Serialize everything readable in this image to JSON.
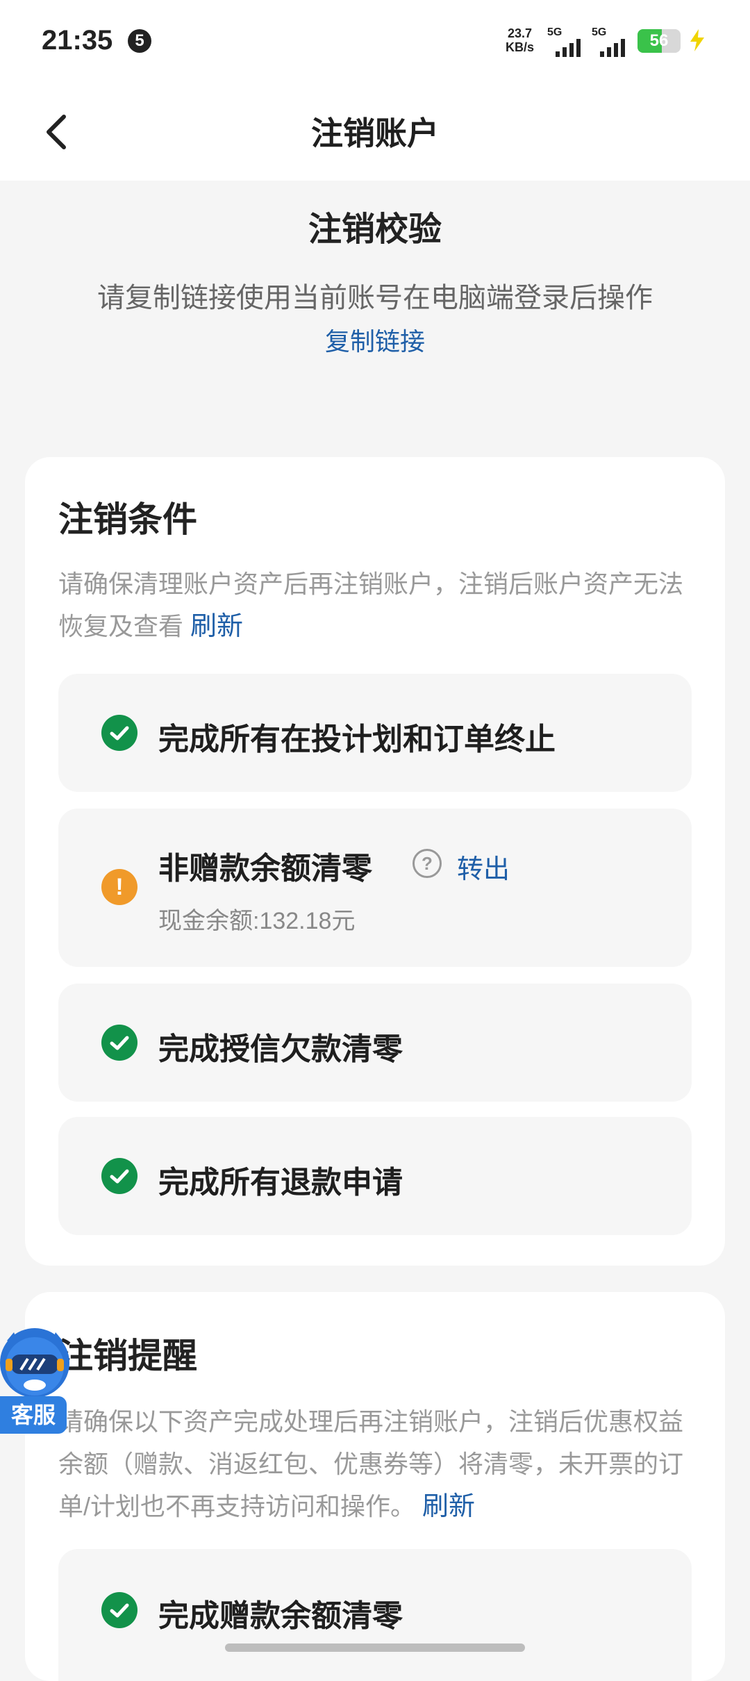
{
  "status": {
    "time": "21:35",
    "notification_count": "5",
    "net_speed_value": "23.7",
    "net_speed_unit": "KB/s",
    "sim1_label": "5G",
    "sim2_label": "5G",
    "battery": "56"
  },
  "nav": {
    "title": "注销账户"
  },
  "verify": {
    "title": "注销校验",
    "desc": "请复制链接使用当前账号在电脑端登录后操作",
    "link": "复制链接"
  },
  "conditions": {
    "title": "注销条件",
    "desc": "请确保清理账户资产后再注销账户，注销后账户资产无法恢复及查看",
    "refresh": "刷新",
    "items": [
      {
        "text": "完成所有在投计划和订单终止",
        "status": "done"
      },
      {
        "text": "非赠款余额清零",
        "status": "warning",
        "help": "?",
        "action": "转出",
        "sub": "现金余额:132.18元",
        "warn_mark": "!"
      },
      {
        "text": "完成授信欠款清零",
        "status": "done"
      },
      {
        "text": "完成所有退款申请",
        "status": "done"
      }
    ]
  },
  "reminder": {
    "title": "注销提醒",
    "desc": "请确保以下资产完成处理后再注销账户，注销后优惠权益余额（赠款、消返红包、优惠券等）将清零，未开票的订单/计划也不再支持访问和操作。",
    "refresh": "刷新",
    "items": [
      {
        "text": "完成赠款余额清零",
        "status": "done"
      }
    ]
  },
  "service": {
    "label": "客服"
  },
  "colors": {
    "link": "#1f5fa8",
    "success": "#12924a",
    "warning": "#f09a2a",
    "background": "#f5f5f5"
  }
}
